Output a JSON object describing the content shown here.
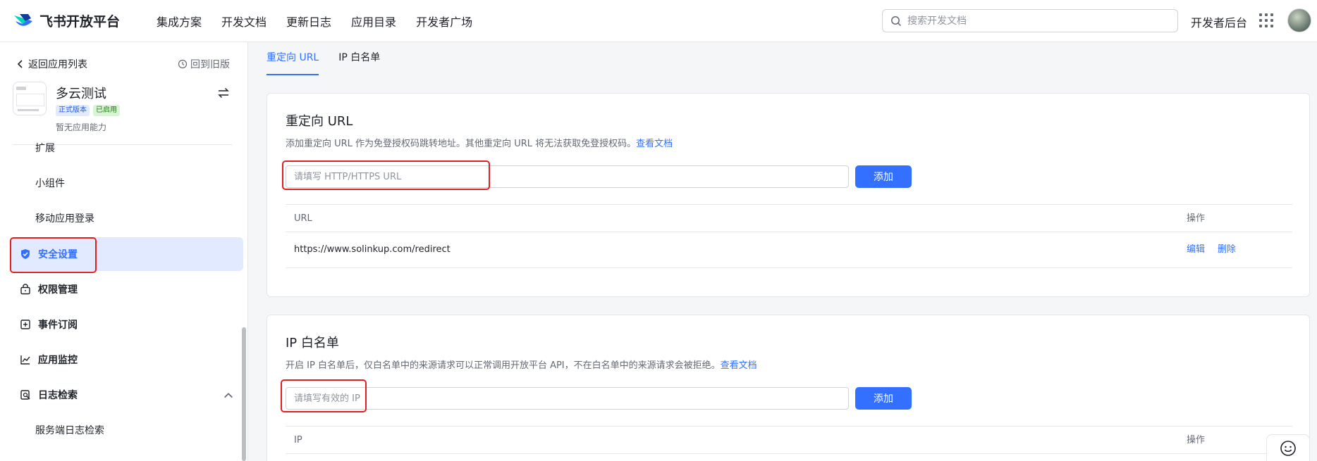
{
  "header": {
    "logo_text": "飞书开放平台",
    "nav": [
      "集成方案",
      "开发文档",
      "更新日志",
      "应用目录",
      "开发者广场"
    ],
    "search_placeholder": "搜索开发文档",
    "dev_console": "开发者后台"
  },
  "sidebar": {
    "back_label": "返回应用列表",
    "old_version_label": "回到旧版",
    "app": {
      "name": "多云测试",
      "tags": [
        "正式版本",
        "已启用"
      ],
      "capability": "暂无应用能力"
    },
    "items": [
      {
        "label": "扩展"
      },
      {
        "label": "小组件"
      },
      {
        "label": "移动应用登录"
      },
      {
        "label": "安全设置",
        "icon": "shield-icon"
      },
      {
        "label": "权限管理",
        "icon": "lock-icon"
      },
      {
        "label": "事件订阅",
        "icon": "event-icon"
      },
      {
        "label": "应用监控",
        "icon": "chart-icon"
      },
      {
        "label": "日志检索",
        "icon": "log-search-icon"
      },
      {
        "label": "服务端日志检索"
      }
    ]
  },
  "tabs": [
    "重定向 URL",
    "IP 白名单"
  ],
  "redirect": {
    "title": "重定向 URL",
    "desc": "添加重定向 URL 作为免登授权码跳转地址。其他重定向 URL 将无法获取免登授权码。",
    "doc_link": "查看文档",
    "placeholder": "请填写 HTTP/HTTPS URL",
    "add_label": "添加",
    "columns": [
      "URL",
      "操作"
    ],
    "rows": [
      {
        "url": "https://www.solinkup.com/redirect",
        "edit": "编辑",
        "delete": "删除"
      }
    ]
  },
  "ip_whitelist": {
    "title": "IP 白名单",
    "desc": "开启 IP 白名单后，仅白名单中的来源请求可以正常调用开放平台 API，不在白名单中的来源请求会被拒绝。",
    "doc_link": "查看文档",
    "placeholder": "请填写有效的 IP",
    "add_label": "添加",
    "columns": [
      "IP",
      "操作"
    ]
  },
  "colors": {
    "accent": "#3370ff",
    "highlight": "#e02020",
    "active_bg": "#e1eaff"
  }
}
